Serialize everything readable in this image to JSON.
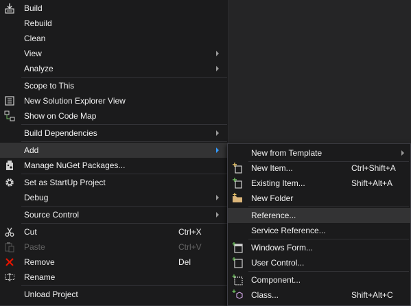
{
  "main_menu": {
    "items": [
      {
        "label": "Build",
        "icon": "build-icon"
      },
      {
        "label": "Rebuild"
      },
      {
        "label": "Clean"
      },
      {
        "label": "View",
        "submenu": true
      },
      {
        "label": "Analyze",
        "submenu": true
      },
      {
        "label": "Scope to This"
      },
      {
        "label": "New Solution Explorer View",
        "icon": "new-solution-explorer-view-icon"
      },
      {
        "label": "Show on Code Map",
        "icon": "code-map-icon"
      },
      {
        "label": "Build Dependencies",
        "submenu": true
      },
      {
        "label": "Add",
        "submenu": true,
        "highlighted": true
      },
      {
        "label": "Manage NuGet Packages...",
        "icon": "nuget-icon"
      },
      {
        "label": "Set as StartUp Project",
        "icon": "gear-icon"
      },
      {
        "label": "Debug",
        "submenu": true
      },
      {
        "label": "Source Control",
        "submenu": true
      },
      {
        "label": "Cut",
        "shortcut": "Ctrl+X",
        "icon": "scissors-icon"
      },
      {
        "label": "Paste",
        "shortcut": "Ctrl+V",
        "icon": "paste-icon",
        "disabled": true
      },
      {
        "label": "Remove",
        "shortcut": "Del",
        "icon": "remove-icon"
      },
      {
        "label": "Rename",
        "icon": "rename-icon"
      },
      {
        "label": "Unload Project"
      }
    ]
  },
  "add_submenu": {
    "items": [
      {
        "label": "New from Template",
        "submenu": true
      },
      {
        "label": "New Item...",
        "shortcut": "Ctrl+Shift+A",
        "icon": "new-item-icon"
      },
      {
        "label": "Existing Item...",
        "shortcut": "Shift+Alt+A",
        "icon": "existing-item-icon"
      },
      {
        "label": "New Folder",
        "icon": "new-folder-icon"
      },
      {
        "label": "Reference...",
        "highlighted": true
      },
      {
        "label": "Service Reference..."
      },
      {
        "label": "Windows Form...",
        "icon": "windows-form-icon"
      },
      {
        "label": "User Control...",
        "icon": "user-control-icon"
      },
      {
        "label": "Component...",
        "icon": "component-icon"
      },
      {
        "label": "Class...",
        "shortcut": "Shift+Alt+C",
        "icon": "class-icon"
      }
    ]
  },
  "colors": {
    "menu_bg": "#1b1b1c",
    "highlight_bg": "#333334",
    "separator": "#333337",
    "text": "#f1f1f1",
    "disabled_text": "#656565",
    "accent_arrow": "#3399ff",
    "remove_icon": "#e51400"
  }
}
